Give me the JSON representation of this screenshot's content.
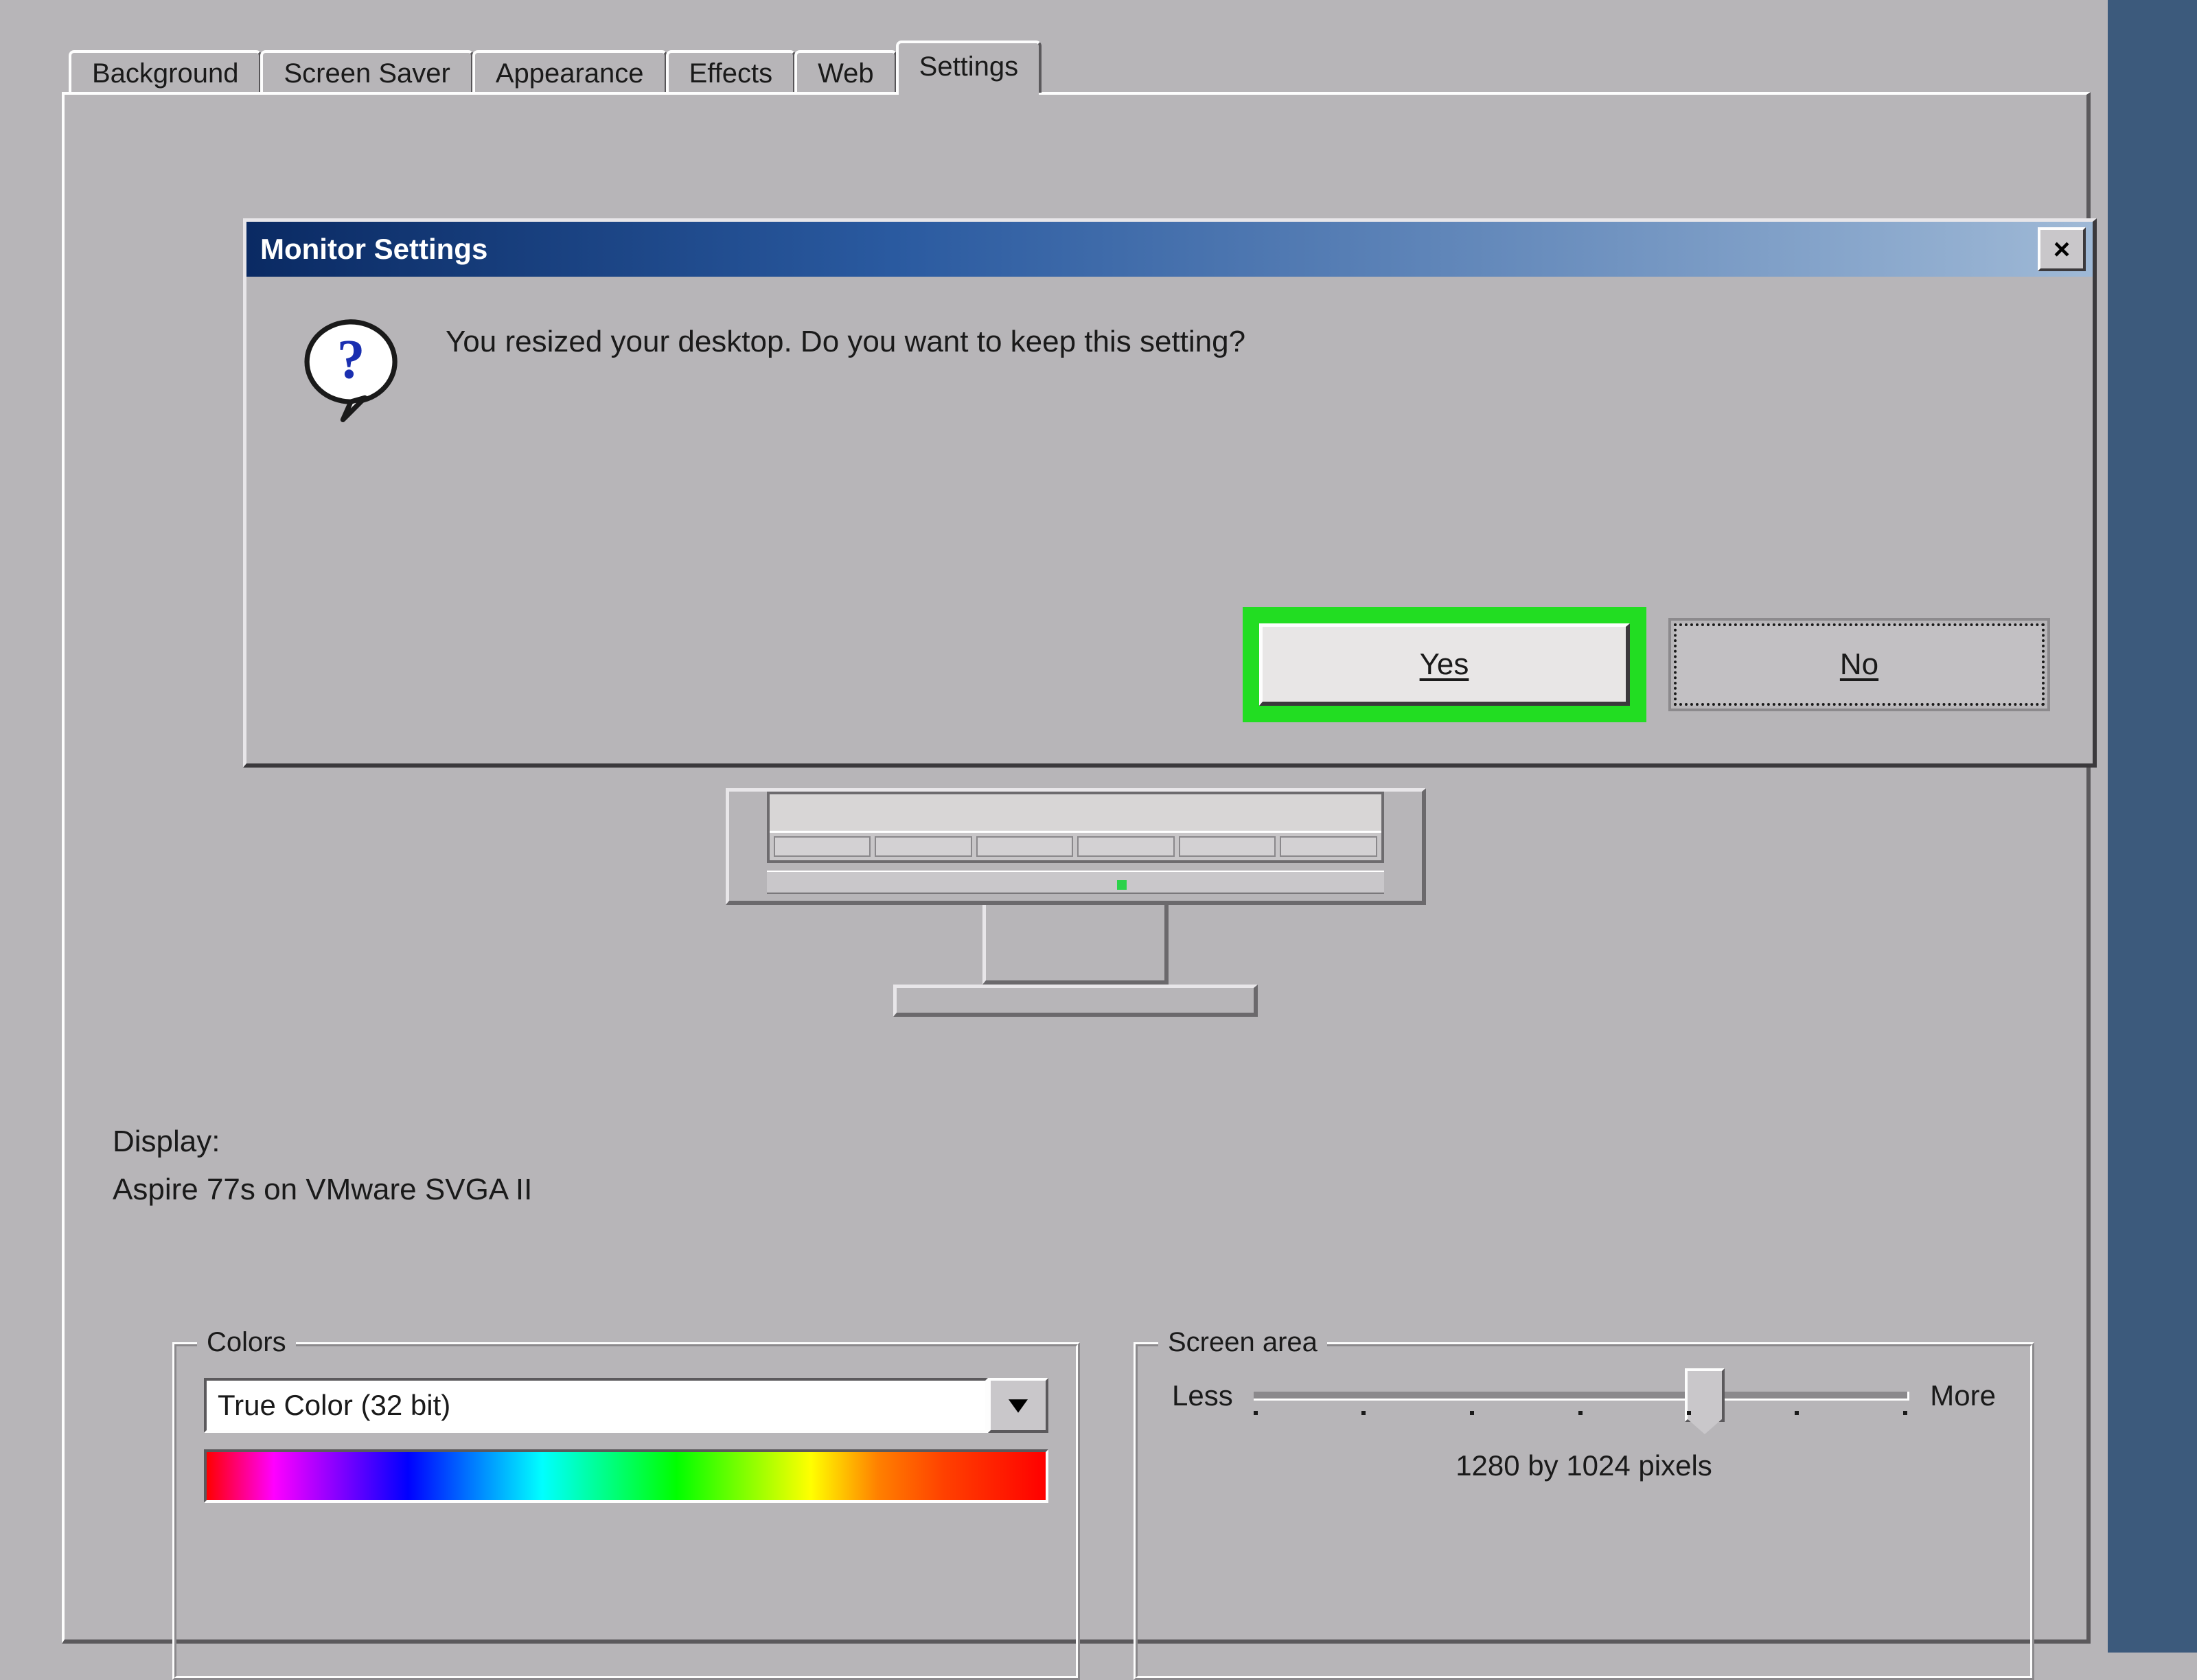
{
  "tabs": {
    "background": "Background",
    "screensaver": "Screen Saver",
    "appearance": "Appearance",
    "effects": "Effects",
    "web": "Web",
    "settings": "Settings"
  },
  "display": {
    "label": "Display:",
    "value": "Aspire 77s on VMware SVGA II"
  },
  "colors": {
    "legend": "Colors",
    "selected": "True Color (32 bit)"
  },
  "screen_area": {
    "legend": "Screen area",
    "less": "Less",
    "more": "More",
    "value": "1280 by 1024 pixels"
  },
  "dialog": {
    "title": "Monitor Settings",
    "message": "You resized your desktop.  Do you want to keep this setting?",
    "yes": "Yes",
    "no": "No",
    "close": "×"
  }
}
